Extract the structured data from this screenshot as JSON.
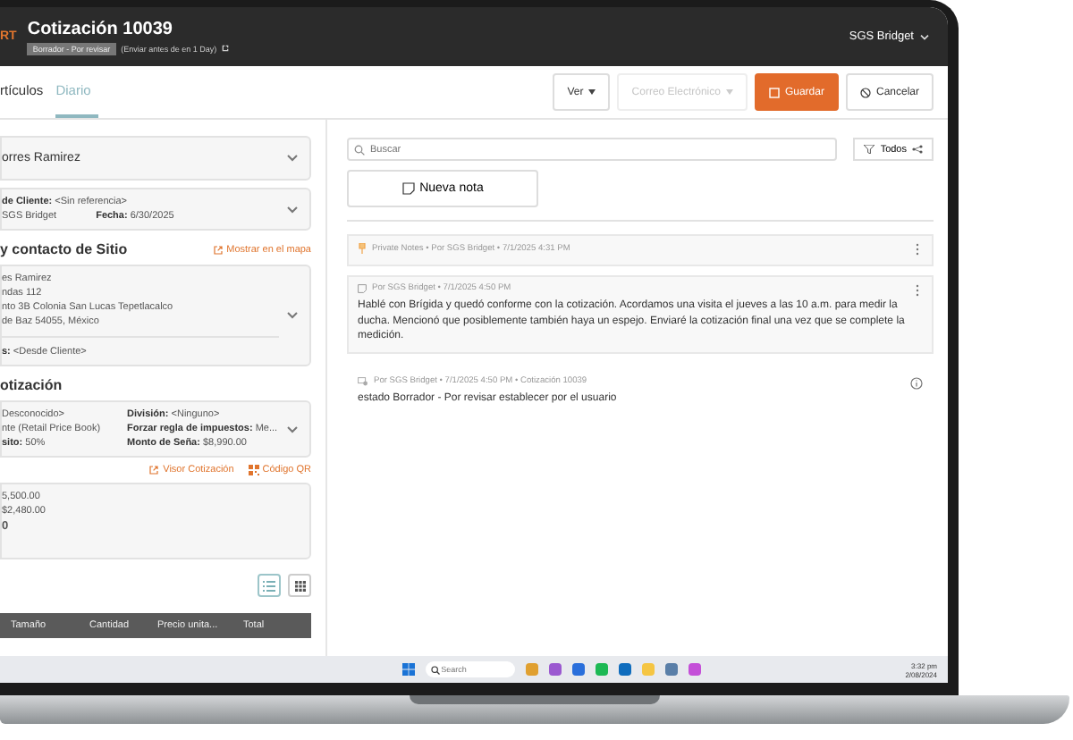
{
  "header": {
    "logo": "RT",
    "title": "Cotización 10039",
    "status_badge": "Borrador - Por revisar",
    "note": "(Enviar antes de en 1 Day)",
    "user": "SGS Bridget"
  },
  "tabs": [
    {
      "label": "rtículos",
      "selected": false
    },
    {
      "label": "Diario",
      "selected": true
    }
  ],
  "actions": [
    {
      "label": "Ver",
      "kind": "dropdown",
      "disabled": false
    },
    {
      "label": "Correo Electrónico",
      "kind": "dropdown",
      "disabled": true
    },
    {
      "label": "Guardar",
      "kind": "primary",
      "disabled": false
    },
    {
      "label": "Cancelar",
      "kind": "secondary",
      "disabled": false
    }
  ],
  "customer": {
    "name": "orres Ramirez"
  },
  "reference": {
    "label": "de Cliente:",
    "value": "<Sin referencia>",
    "owner": "SGS Bridget",
    "date_label": "Fecha:",
    "date": "6/30/2025"
  },
  "site": {
    "heading": "y contacto de Sitio",
    "map_link": "Mostrar en el mapa",
    "address": [
      "es Ramirez",
      "ndas 112",
      "nto 3B Colonia San Lucas Tepetlacalco",
      "de Baz 54055, México"
    ],
    "contact_label": "s:",
    "contact": "<Desde Cliente>"
  },
  "quote": {
    "heading": "otización",
    "left": [
      {
        "value": "Desconocido>"
      },
      {
        "value": "nte (Retail Price Book)"
      },
      {
        "label": "sito:",
        "value": "50%"
      }
    ],
    "right": [
      {
        "label": "División:",
        "value": "<Ninguno>"
      },
      {
        "label": "Forzar regla de impuestos:",
        "value": "Me..."
      },
      {
        "label": "Monto de Seña:",
        "value": "$8,990.00"
      }
    ]
  },
  "links": [
    {
      "label": "Visor Cotización",
      "kind": "external"
    },
    {
      "label": "Código QR",
      "kind": "qr"
    }
  ],
  "totals": [
    "5,500.00",
    "$2,480.00",
    "0"
  ],
  "view_toggle": [
    {
      "kind": "list",
      "selected": true
    },
    {
      "kind": "grid",
      "selected": false
    }
  ],
  "table": {
    "columns": [
      "Tamaño",
      "Cantidad",
      "Precio unita...",
      "Total"
    ]
  },
  "journal": {
    "search": {
      "placeholder": "Buscar"
    },
    "filter": "Todos",
    "new_note": "Nueva nota",
    "notes": [
      {
        "kind": "private",
        "meta": "Private Notes • Por SGS Bridget • 7/1/2025 4:31 PM"
      },
      {
        "kind": "note",
        "meta": "Por SGS Bridget • 7/1/2025 4:50 PM",
        "body": "Hablé con Brígida y quedó conforme con la cotización. Acordamos una visita el jueves a las 10 a.m. para medir la ducha. Mencionó que posiblemente también haya un espejo. Enviaré la cotización final una vez que se complete la medición."
      },
      {
        "kind": "system",
        "meta": "Por SGS Bridget • 7/1/2025 4:50 PM • Cotización 10039",
        "body": "estado Borrador - Por revisar establecer por el usuario"
      }
    ]
  },
  "taskbar": {
    "search": {
      "placeholder": "Search"
    },
    "time": "3:32 pm",
    "date": "2/08/2024"
  }
}
